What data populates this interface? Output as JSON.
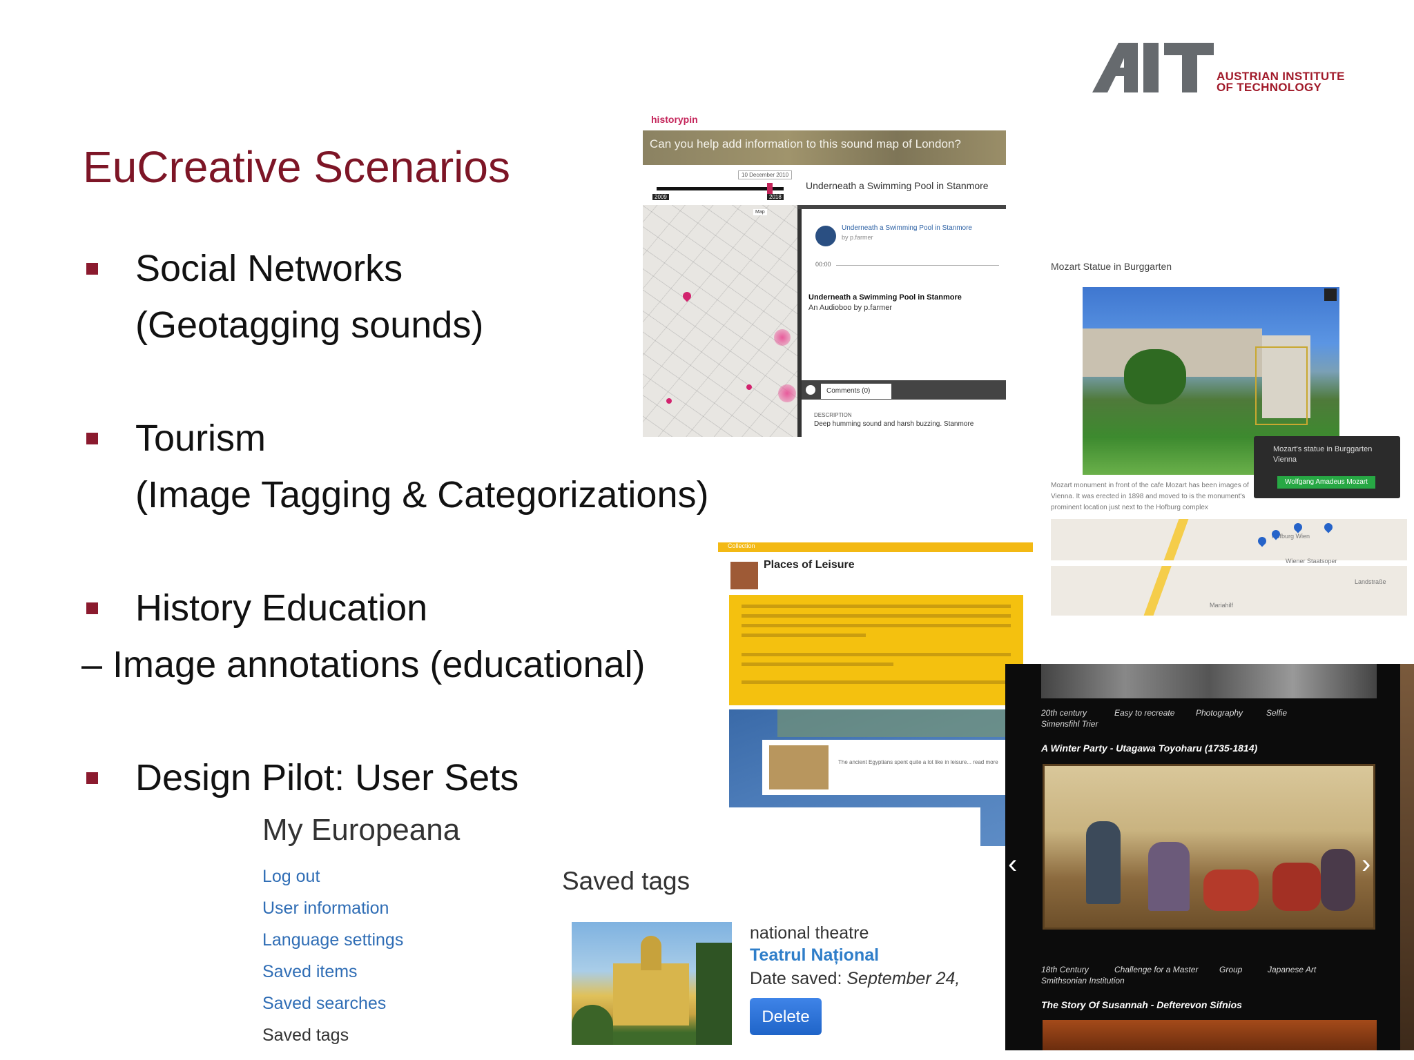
{
  "slide": {
    "title": "EuCreative Scenarios",
    "bullets": [
      {
        "line1": "Social Networks",
        "line2": "(Geotagging sounds)"
      },
      {
        "line1": "Tourism",
        "line2": "(Image Tagging & Categorizations)"
      },
      {
        "line1": "History Education",
        "line2": "– Image annotations (educational)"
      },
      {
        "line1": "Design Pilot: User Sets"
      }
    ]
  },
  "logo": {
    "mark": "AIT",
    "line1": "AUSTRIAN INSTITUTE",
    "line2": "OF TECHNOLOGY",
    "color": "#a11a2a"
  },
  "historypin": {
    "brand": "historypin",
    "banner": "Can you help add information to this sound map of London?",
    "date_label": "10 December 2010",
    "year_start": "2009",
    "year_end": "2018",
    "map_btn": "Map",
    "right_title": "Underneath a Swimming Pool in Stanmore",
    "audio_title": "Underneath a Swimming Pool in Stanmore",
    "audio_byline": "by p.farmer",
    "time": "00:00",
    "record_title": "Underneath a Swimming Pool in Stanmore",
    "record_by": "An Audioboo by p.farmer",
    "comments": "Comments (0)",
    "desc_label": "DESCRIPTION",
    "desc": "Deep humming sound and harsh buzzing. Stanmore"
  },
  "mozart": {
    "title": "Mozart Statue in Burggarten",
    "caption": "Mozart's statue in Burggarten Vienna",
    "name_tag": "Wolfgang Amadeus Mozart",
    "text": "Mozart monument in front of the cafe Mozart has been images of Vienna. It was erected in 1898 and moved to is the monument's prominent location just next to the Hofburg complex",
    "map_labels": [
      "Hofburg Wien",
      "Wiener Staatsoper",
      "Landstraße",
      "Mariahilf"
    ]
  },
  "leisure": {
    "header": "Collection",
    "title": "Places of Leisure",
    "popup_text": "The ancient Egyptians spent quite a lot like in leisure... read more"
  },
  "ukiyoe": {
    "tags_top": [
      "20th century",
      "Easy to recreate",
      "Photography",
      "Selfie",
      "Simensfihl Trier"
    ],
    "title": "A Winter Party - Utagawa Toyoharu (1735-1814)",
    "tags_bottom": [
      "18th Century",
      "Challenge for a Master",
      "Group",
      "Japanese Art",
      "Smithsonian Institution"
    ],
    "title2": "The Story Of Susannah - Defterevon Sifnios"
  },
  "europeana": {
    "title": "My Europeana",
    "links": [
      "Log out",
      "User information",
      "Language settings",
      "Saved items",
      "Saved searches"
    ],
    "active": "Saved tags",
    "saved_title": "Saved tags",
    "tag_name": "national theatre",
    "tag_link": "Teatrul Național",
    "date_label": "Date saved:",
    "date_value": "September 24,",
    "delete_label": "Delete"
  }
}
